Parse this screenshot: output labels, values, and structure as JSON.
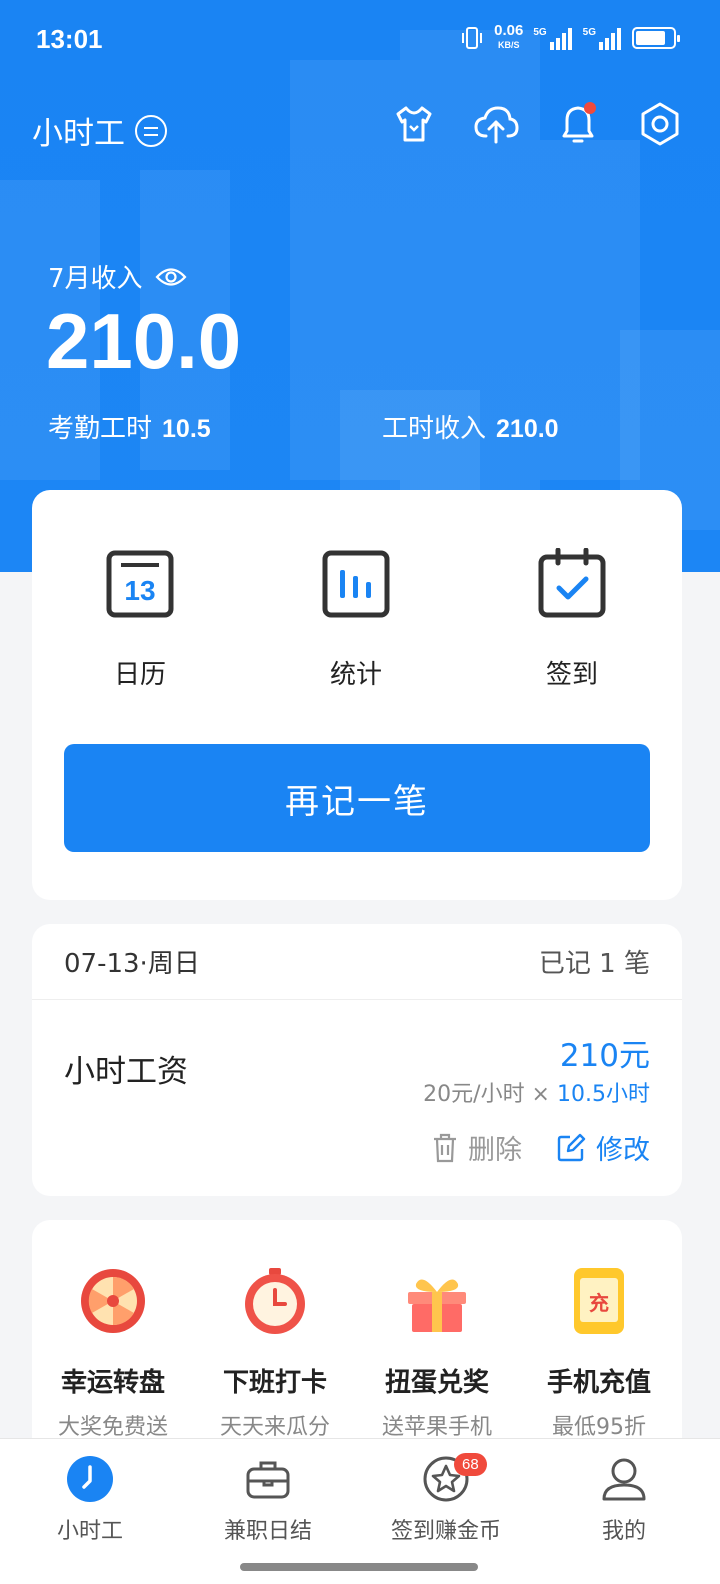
{
  "status_bar": {
    "time": "13:01",
    "net_speed": "0.06",
    "net_unit": "KB/S",
    "sim1": "5G",
    "sim2": "5G",
    "battery_level": 0.8
  },
  "header": {
    "app_title": "小时工"
  },
  "summary": {
    "month_label": "7月收入",
    "amount": "210.0",
    "attendance_label": "考勤工时",
    "attendance_value": "10.5",
    "hour_income_label": "工时收入",
    "hour_income_value": "210.0"
  },
  "actions": {
    "items": [
      {
        "label": "日历",
        "day": "13"
      },
      {
        "label": "统计"
      },
      {
        "label": "签到"
      }
    ],
    "record_button": "再记一笔"
  },
  "day_record": {
    "date": "07-13·周日",
    "count_text": "已记 1 笔",
    "entry_name": "小时工资",
    "entry_amount": "210元",
    "rate": "20元/小时 ×",
    "hours": "10.5小时",
    "delete_label": "删除",
    "edit_label": "修改"
  },
  "promos": [
    {
      "title": "幸运转盘",
      "subtitle": "大奖免费送"
    },
    {
      "title": "下班打卡",
      "subtitle": "天天来瓜分"
    },
    {
      "title": "扭蛋兑奖",
      "subtitle": "送苹果手机"
    },
    {
      "title": "手机充值",
      "subtitle": "最低95折",
      "icon_text": "充"
    }
  ],
  "tabs": [
    {
      "label": "小时工"
    },
    {
      "label": "兼职日结"
    },
    {
      "label": "签到赚金币",
      "badge": "68"
    },
    {
      "label": "我的"
    }
  ],
  "colors": {
    "brand": "#1a84f3",
    "badge": "#f04a3c"
  }
}
